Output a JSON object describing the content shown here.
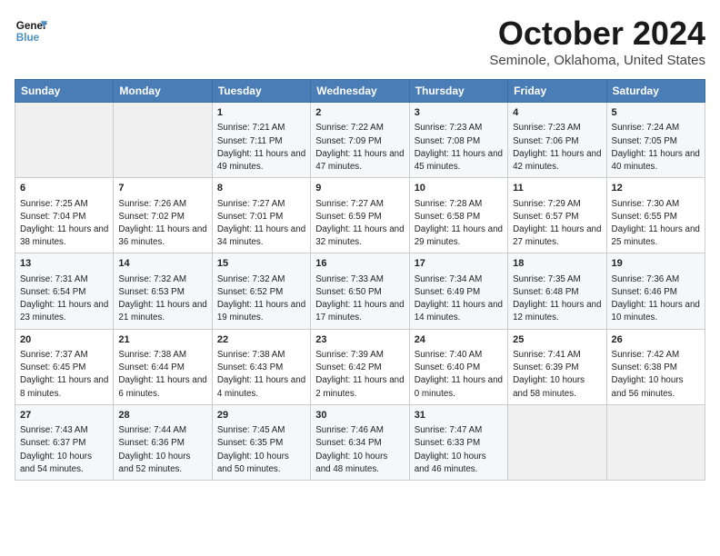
{
  "header": {
    "logo_line1": "General",
    "logo_line2": "Blue",
    "title": "October 2024",
    "subtitle": "Seminole, Oklahoma, United States"
  },
  "columns": [
    "Sunday",
    "Monday",
    "Tuesday",
    "Wednesday",
    "Thursday",
    "Friday",
    "Saturday"
  ],
  "weeks": [
    [
      {
        "day": "",
        "info": ""
      },
      {
        "day": "",
        "info": ""
      },
      {
        "day": "1",
        "info": "Sunrise: 7:21 AM\nSunset: 7:11 PM\nDaylight: 11 hours and 49 minutes."
      },
      {
        "day": "2",
        "info": "Sunrise: 7:22 AM\nSunset: 7:09 PM\nDaylight: 11 hours and 47 minutes."
      },
      {
        "day": "3",
        "info": "Sunrise: 7:23 AM\nSunset: 7:08 PM\nDaylight: 11 hours and 45 minutes."
      },
      {
        "day": "4",
        "info": "Sunrise: 7:23 AM\nSunset: 7:06 PM\nDaylight: 11 hours and 42 minutes."
      },
      {
        "day": "5",
        "info": "Sunrise: 7:24 AM\nSunset: 7:05 PM\nDaylight: 11 hours and 40 minutes."
      }
    ],
    [
      {
        "day": "6",
        "info": "Sunrise: 7:25 AM\nSunset: 7:04 PM\nDaylight: 11 hours and 38 minutes."
      },
      {
        "day": "7",
        "info": "Sunrise: 7:26 AM\nSunset: 7:02 PM\nDaylight: 11 hours and 36 minutes."
      },
      {
        "day": "8",
        "info": "Sunrise: 7:27 AM\nSunset: 7:01 PM\nDaylight: 11 hours and 34 minutes."
      },
      {
        "day": "9",
        "info": "Sunrise: 7:27 AM\nSunset: 6:59 PM\nDaylight: 11 hours and 32 minutes."
      },
      {
        "day": "10",
        "info": "Sunrise: 7:28 AM\nSunset: 6:58 PM\nDaylight: 11 hours and 29 minutes."
      },
      {
        "day": "11",
        "info": "Sunrise: 7:29 AM\nSunset: 6:57 PM\nDaylight: 11 hours and 27 minutes."
      },
      {
        "day": "12",
        "info": "Sunrise: 7:30 AM\nSunset: 6:55 PM\nDaylight: 11 hours and 25 minutes."
      }
    ],
    [
      {
        "day": "13",
        "info": "Sunrise: 7:31 AM\nSunset: 6:54 PM\nDaylight: 11 hours and 23 minutes."
      },
      {
        "day": "14",
        "info": "Sunrise: 7:32 AM\nSunset: 6:53 PM\nDaylight: 11 hours and 21 minutes."
      },
      {
        "day": "15",
        "info": "Sunrise: 7:32 AM\nSunset: 6:52 PM\nDaylight: 11 hours and 19 minutes."
      },
      {
        "day": "16",
        "info": "Sunrise: 7:33 AM\nSunset: 6:50 PM\nDaylight: 11 hours and 17 minutes."
      },
      {
        "day": "17",
        "info": "Sunrise: 7:34 AM\nSunset: 6:49 PM\nDaylight: 11 hours and 14 minutes."
      },
      {
        "day": "18",
        "info": "Sunrise: 7:35 AM\nSunset: 6:48 PM\nDaylight: 11 hours and 12 minutes."
      },
      {
        "day": "19",
        "info": "Sunrise: 7:36 AM\nSunset: 6:46 PM\nDaylight: 11 hours and 10 minutes."
      }
    ],
    [
      {
        "day": "20",
        "info": "Sunrise: 7:37 AM\nSunset: 6:45 PM\nDaylight: 11 hours and 8 minutes."
      },
      {
        "day": "21",
        "info": "Sunrise: 7:38 AM\nSunset: 6:44 PM\nDaylight: 11 hours and 6 minutes."
      },
      {
        "day": "22",
        "info": "Sunrise: 7:38 AM\nSunset: 6:43 PM\nDaylight: 11 hours and 4 minutes."
      },
      {
        "day": "23",
        "info": "Sunrise: 7:39 AM\nSunset: 6:42 PM\nDaylight: 11 hours and 2 minutes."
      },
      {
        "day": "24",
        "info": "Sunrise: 7:40 AM\nSunset: 6:40 PM\nDaylight: 11 hours and 0 minutes."
      },
      {
        "day": "25",
        "info": "Sunrise: 7:41 AM\nSunset: 6:39 PM\nDaylight: 10 hours and 58 minutes."
      },
      {
        "day": "26",
        "info": "Sunrise: 7:42 AM\nSunset: 6:38 PM\nDaylight: 10 hours and 56 minutes."
      }
    ],
    [
      {
        "day": "27",
        "info": "Sunrise: 7:43 AM\nSunset: 6:37 PM\nDaylight: 10 hours and 54 minutes."
      },
      {
        "day": "28",
        "info": "Sunrise: 7:44 AM\nSunset: 6:36 PM\nDaylight: 10 hours and 52 minutes."
      },
      {
        "day": "29",
        "info": "Sunrise: 7:45 AM\nSunset: 6:35 PM\nDaylight: 10 hours and 50 minutes."
      },
      {
        "day": "30",
        "info": "Sunrise: 7:46 AM\nSunset: 6:34 PM\nDaylight: 10 hours and 48 minutes."
      },
      {
        "day": "31",
        "info": "Sunrise: 7:47 AM\nSunset: 6:33 PM\nDaylight: 10 hours and 46 minutes."
      },
      {
        "day": "",
        "info": ""
      },
      {
        "day": "",
        "info": ""
      }
    ]
  ]
}
